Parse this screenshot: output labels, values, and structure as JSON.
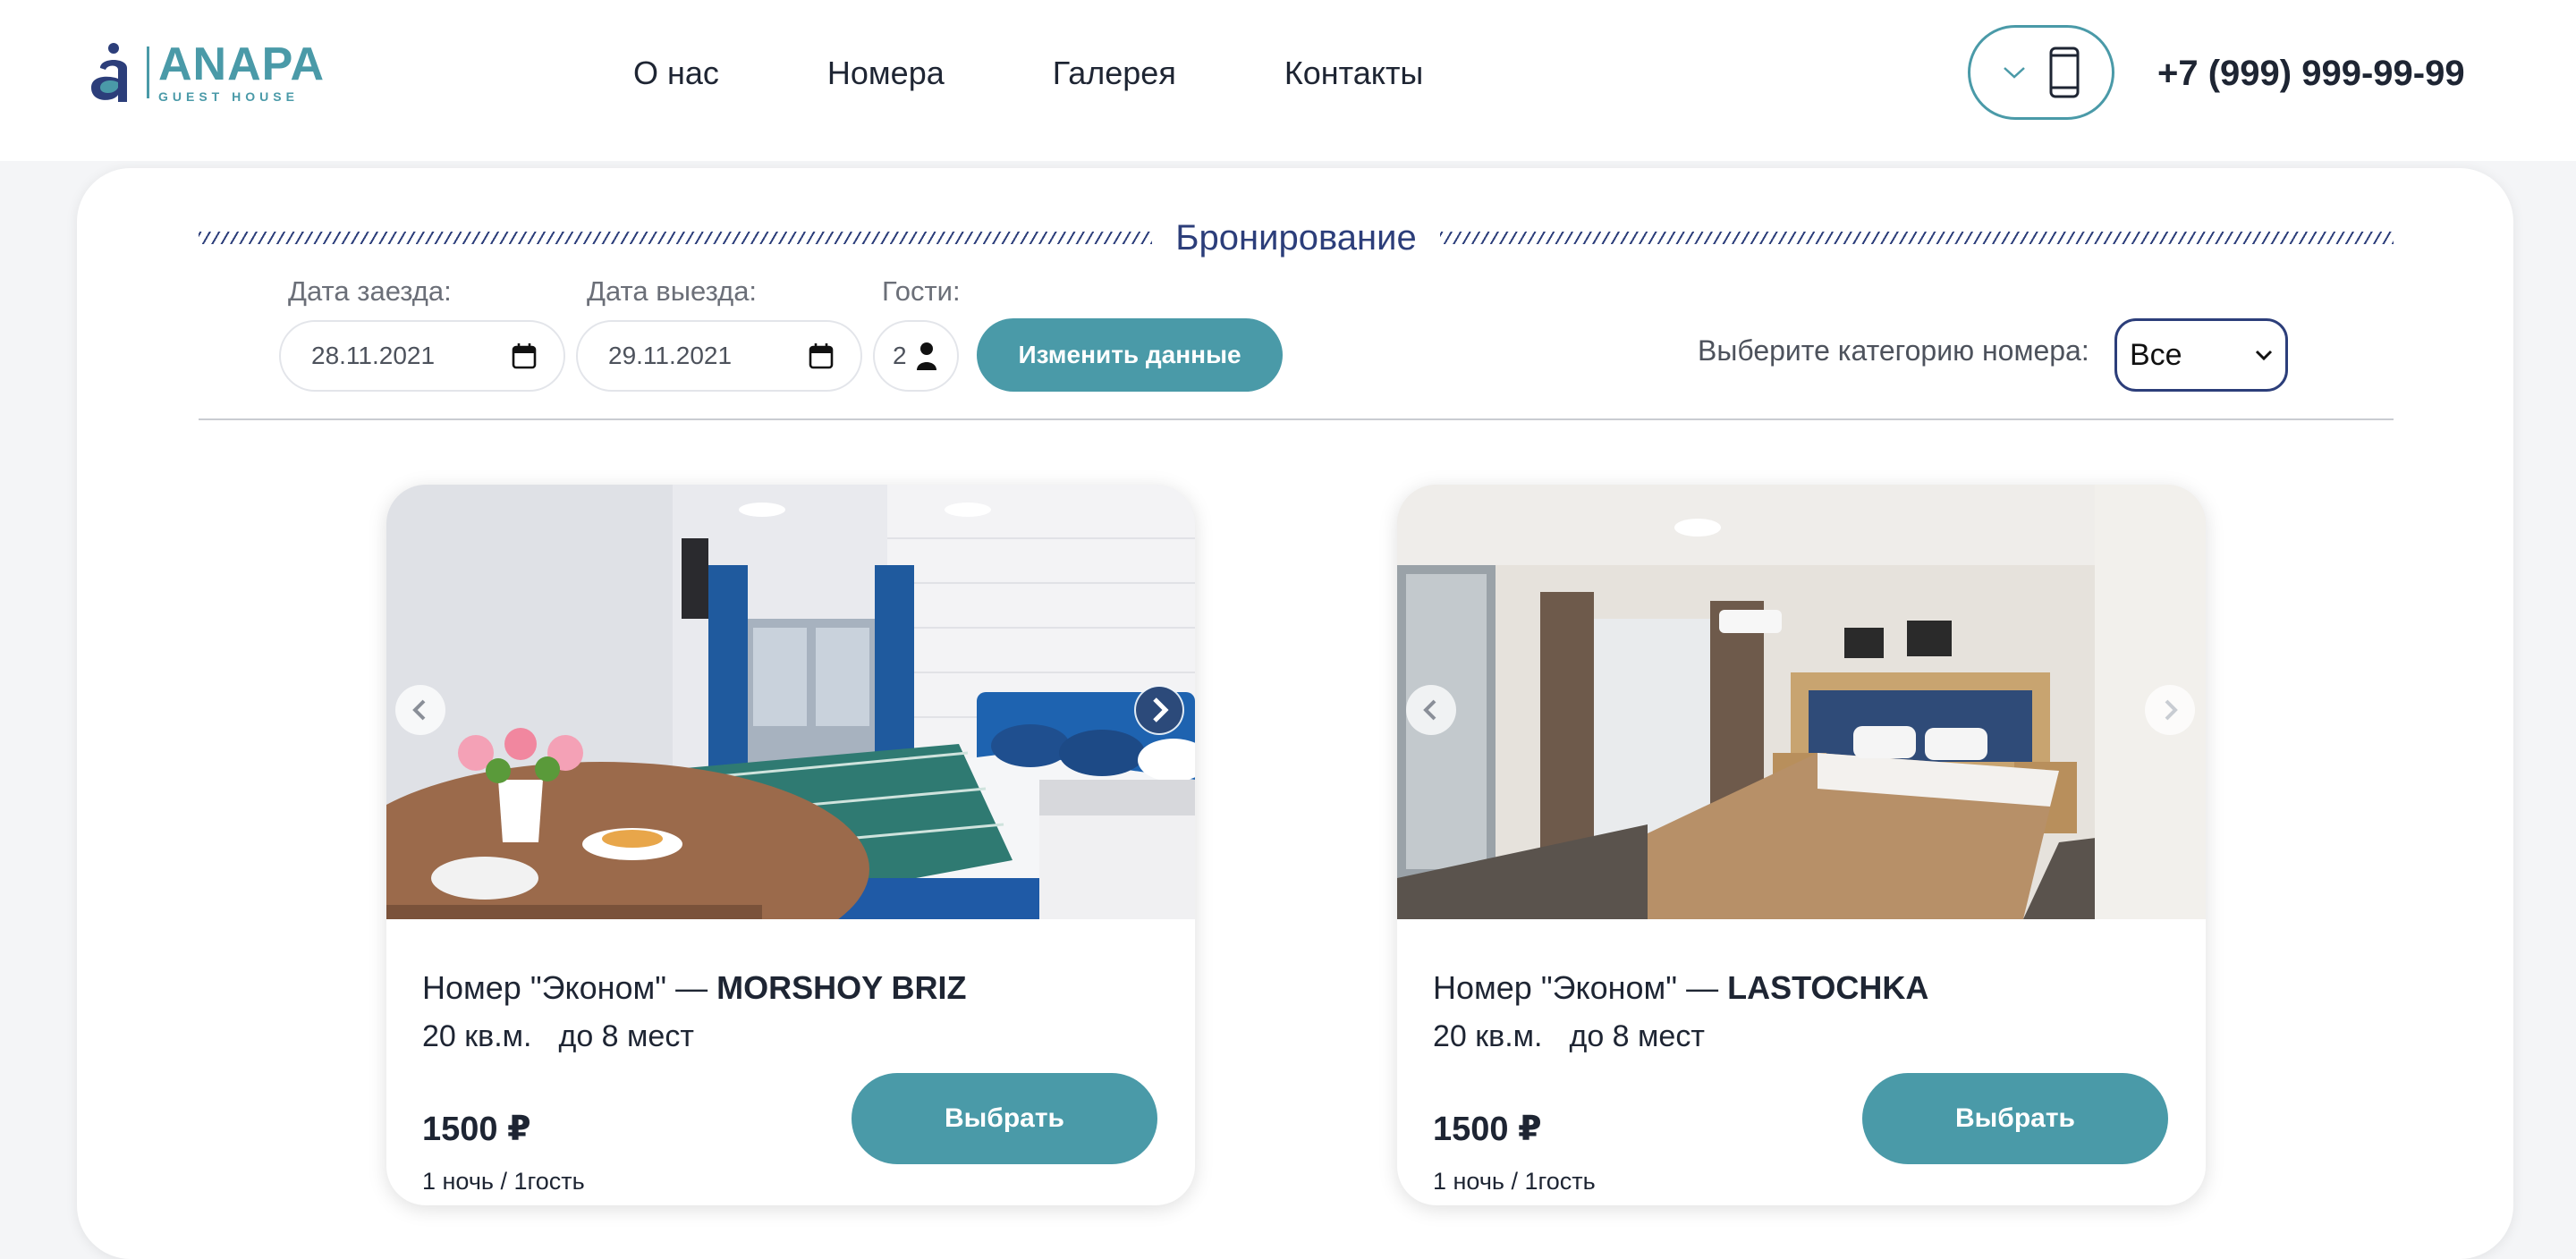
{
  "brand": {
    "name": "ANAPA",
    "tagline": "GUEST HOUSE",
    "color": "#4a9aa8"
  },
  "nav": {
    "items": [
      "О нас",
      "Номера",
      "Галерея",
      "Контакты"
    ]
  },
  "contact": {
    "phone": "+7 (999) 999-99-99"
  },
  "booking": {
    "title": "Бронирование",
    "checkin_label": "Дата заезда:",
    "checkin_value": "28.11.2021",
    "checkout_label": "Дата выезда:",
    "checkout_value": "29.11.2021",
    "guests_label": "Гости:",
    "guests_value": "2",
    "change_button": "Изменить данные",
    "category_label": "Выберите категорию номера:",
    "category_value": "Все"
  },
  "rooms": [
    {
      "title_prefix": "Номер \"Эконом\" — ",
      "title_name": "MORSHOY BRIZ",
      "area": "20 кв.м.",
      "capacity": "до 8 мест",
      "price": "1500 ₽",
      "price_unit": "1 ночь / 1гость",
      "button": "Выбрать"
    },
    {
      "title_prefix": "Номер \"Эконом\" — ",
      "title_name": "LASTOCHKA",
      "area": "20 кв.м.",
      "capacity": "до 8 мест",
      "price": "1500 ₽",
      "price_unit": "1 ночь / 1гость",
      "button": "Выбрать"
    }
  ],
  "colors": {
    "accent": "#4a9aa8",
    "navy": "#2c3e7a",
    "text": "#1e2533"
  }
}
